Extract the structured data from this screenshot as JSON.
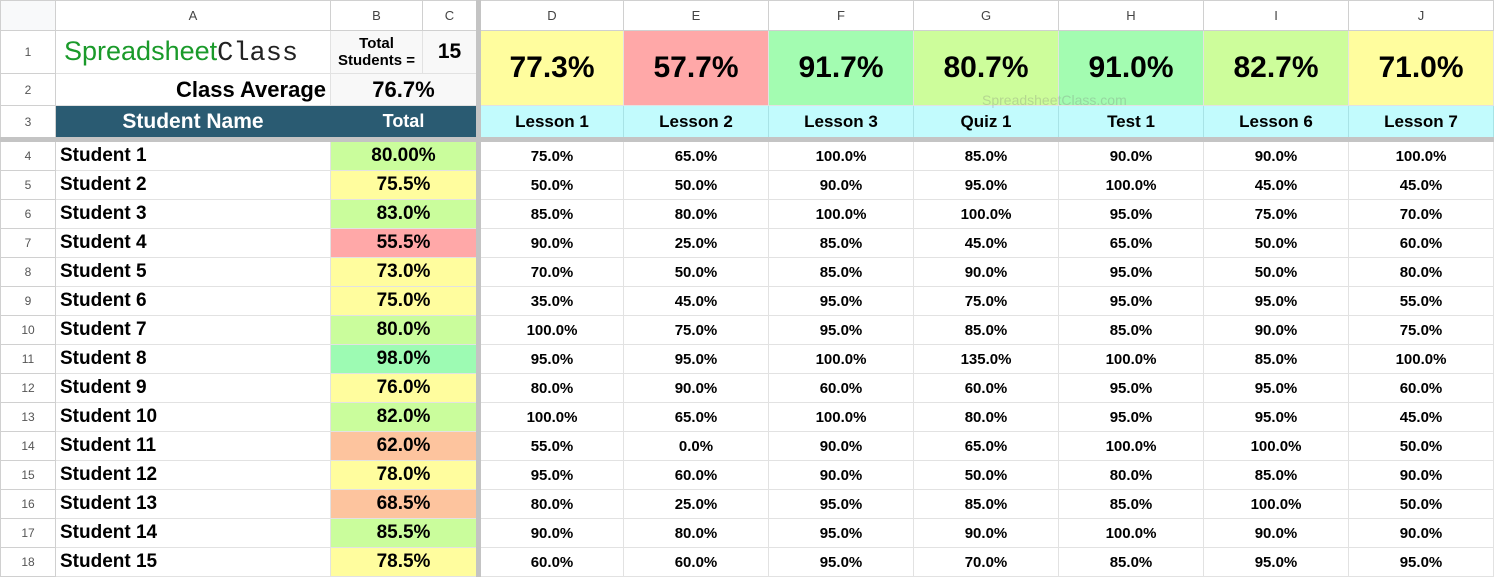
{
  "sheet": {
    "column_letters": [
      "A",
      "B",
      "C",
      "D",
      "E",
      "F",
      "G",
      "H",
      "I",
      "J"
    ],
    "row_numbers": [
      "1",
      "2",
      "3",
      "4",
      "5",
      "6",
      "7",
      "8",
      "9",
      "10",
      "11",
      "12",
      "13",
      "14",
      "15",
      "16",
      "17",
      "18"
    ],
    "brand": {
      "part1": "Spreadsheet",
      "part2": "Class"
    },
    "total_students_label": "Total Students =",
    "total_students_value": "15",
    "class_average_label": "Class Average",
    "class_average_value": "76.7%",
    "header": {
      "student_name": "Student Name",
      "total": "Total"
    },
    "watermark": "SpreadsheetClass.com",
    "assignments": [
      {
        "name": "Lesson 1",
        "average": "77.3%",
        "color": "#fffd9e"
      },
      {
        "name": "Lesson 2",
        "average": "57.7%",
        "color": "#ffa8a8"
      },
      {
        "name": "Lesson 3",
        "average": "91.7%",
        "color": "#a3fcb1"
      },
      {
        "name": "Quiz 1",
        "average": "80.7%",
        "color": "#cdfd9b"
      },
      {
        "name": "Test 1",
        "average": "91.0%",
        "color": "#a3fcb1"
      },
      {
        "name": "Lesson 6",
        "average": "82.7%",
        "color": "#cdfd9b"
      },
      {
        "name": "Lesson 7",
        "average": "71.0%",
        "color": "#fffd9e"
      }
    ],
    "students": [
      {
        "name": "Student 1",
        "total": "80.00%",
        "color": "#cafd9c",
        "scores": [
          "75.0%",
          "65.0%",
          "100.0%",
          "85.0%",
          "90.0%",
          "90.0%",
          "100.0%"
        ]
      },
      {
        "name": "Student 2",
        "total": "75.5%",
        "color": "#fffd9e",
        "scores": [
          "50.0%",
          "50.0%",
          "90.0%",
          "95.0%",
          "100.0%",
          "45.0%",
          "45.0%"
        ]
      },
      {
        "name": "Student 3",
        "total": "83.0%",
        "color": "#cafd9c",
        "scores": [
          "85.0%",
          "80.0%",
          "100.0%",
          "100.0%",
          "95.0%",
          "75.0%",
          "70.0%"
        ]
      },
      {
        "name": "Student 4",
        "total": "55.5%",
        "color": "#ffa8a8",
        "scores": [
          "90.0%",
          "25.0%",
          "85.0%",
          "45.0%",
          "65.0%",
          "50.0%",
          "60.0%"
        ]
      },
      {
        "name": "Student 5",
        "total": "73.0%",
        "color": "#fffd9e",
        "scores": [
          "70.0%",
          "50.0%",
          "85.0%",
          "90.0%",
          "95.0%",
          "50.0%",
          "80.0%"
        ]
      },
      {
        "name": "Student 6",
        "total": "75.0%",
        "color": "#fffd9e",
        "scores": [
          "35.0%",
          "45.0%",
          "95.0%",
          "75.0%",
          "95.0%",
          "95.0%",
          "55.0%"
        ]
      },
      {
        "name": "Student 7",
        "total": "80.0%",
        "color": "#cafd9c",
        "scores": [
          "100.0%",
          "75.0%",
          "95.0%",
          "85.0%",
          "85.0%",
          "90.0%",
          "75.0%"
        ]
      },
      {
        "name": "Student 8",
        "total": "98.0%",
        "color": "#9dfbb3",
        "scores": [
          "95.0%",
          "95.0%",
          "100.0%",
          "135.0%",
          "100.0%",
          "85.0%",
          "100.0%"
        ]
      },
      {
        "name": "Student 9",
        "total": "76.0%",
        "color": "#fffd9e",
        "scores": [
          "80.0%",
          "90.0%",
          "60.0%",
          "60.0%",
          "95.0%",
          "95.0%",
          "60.0%"
        ]
      },
      {
        "name": "Student 10",
        "total": "82.0%",
        "color": "#cafd9c",
        "scores": [
          "100.0%",
          "65.0%",
          "100.0%",
          "80.0%",
          "95.0%",
          "95.0%",
          "45.0%"
        ]
      },
      {
        "name": "Student 11",
        "total": "62.0%",
        "color": "#fdc49e",
        "scores": [
          "55.0%",
          "0.0%",
          "90.0%",
          "65.0%",
          "100.0%",
          "100.0%",
          "50.0%"
        ]
      },
      {
        "name": "Student 12",
        "total": "78.0%",
        "color": "#fffd9e",
        "scores": [
          "95.0%",
          "60.0%",
          "90.0%",
          "50.0%",
          "80.0%",
          "85.0%",
          "90.0%"
        ]
      },
      {
        "name": "Student 13",
        "total": "68.5%",
        "color": "#fdc49e",
        "scores": [
          "80.0%",
          "25.0%",
          "95.0%",
          "85.0%",
          "85.0%",
          "100.0%",
          "50.0%"
        ]
      },
      {
        "name": "Student 14",
        "total": "85.5%",
        "color": "#cafd9c",
        "scores": [
          "90.0%",
          "80.0%",
          "95.0%",
          "90.0%",
          "100.0%",
          "90.0%",
          "90.0%"
        ]
      },
      {
        "name": "Student 15",
        "total": "78.5%",
        "color": "#fffd9e",
        "scores": [
          "60.0%",
          "60.0%",
          "95.0%",
          "70.0%",
          "85.0%",
          "95.0%",
          "95.0%"
        ]
      }
    ]
  }
}
